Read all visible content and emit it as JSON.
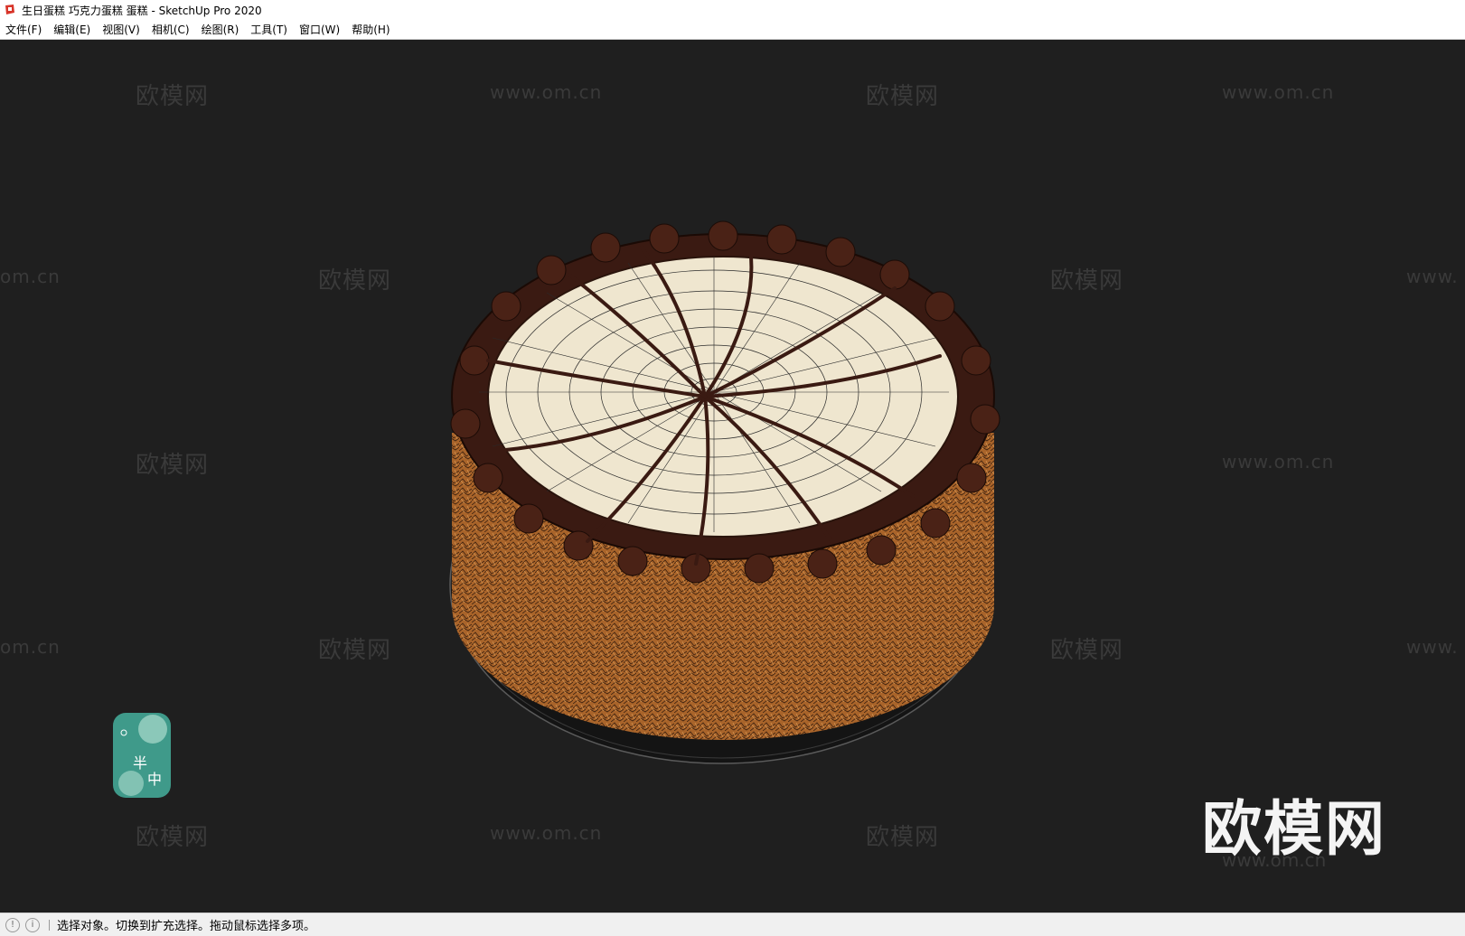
{
  "window": {
    "title": "生日蛋糕 巧克力蛋糕 蛋糕 - SketchUp Pro 2020"
  },
  "menu": {
    "items": [
      "文件(F)",
      "编辑(E)",
      "视图(V)",
      "相机(C)",
      "绘图(R)",
      "工具(T)",
      "窗口(W)",
      "帮助(H)"
    ]
  },
  "watermarks": {
    "brand": "欧模网",
    "url": "www.om.cn",
    "url_partial_left": "om.cn",
    "url_partial_right": "www.",
    "big_brand": "欧模网"
  },
  "badge": {
    "char1": "半",
    "char2": "中"
  },
  "status": {
    "message": "选择对象。切换到扩充选择。拖动鼠标选择多项。"
  },
  "colors": {
    "viewport_bg": "#1f1f1f",
    "cake_top": "#efe6cf",
    "cake_side": "#b06a2c",
    "chocolate": "#3a1a12",
    "badge": "#3f9a8a"
  }
}
